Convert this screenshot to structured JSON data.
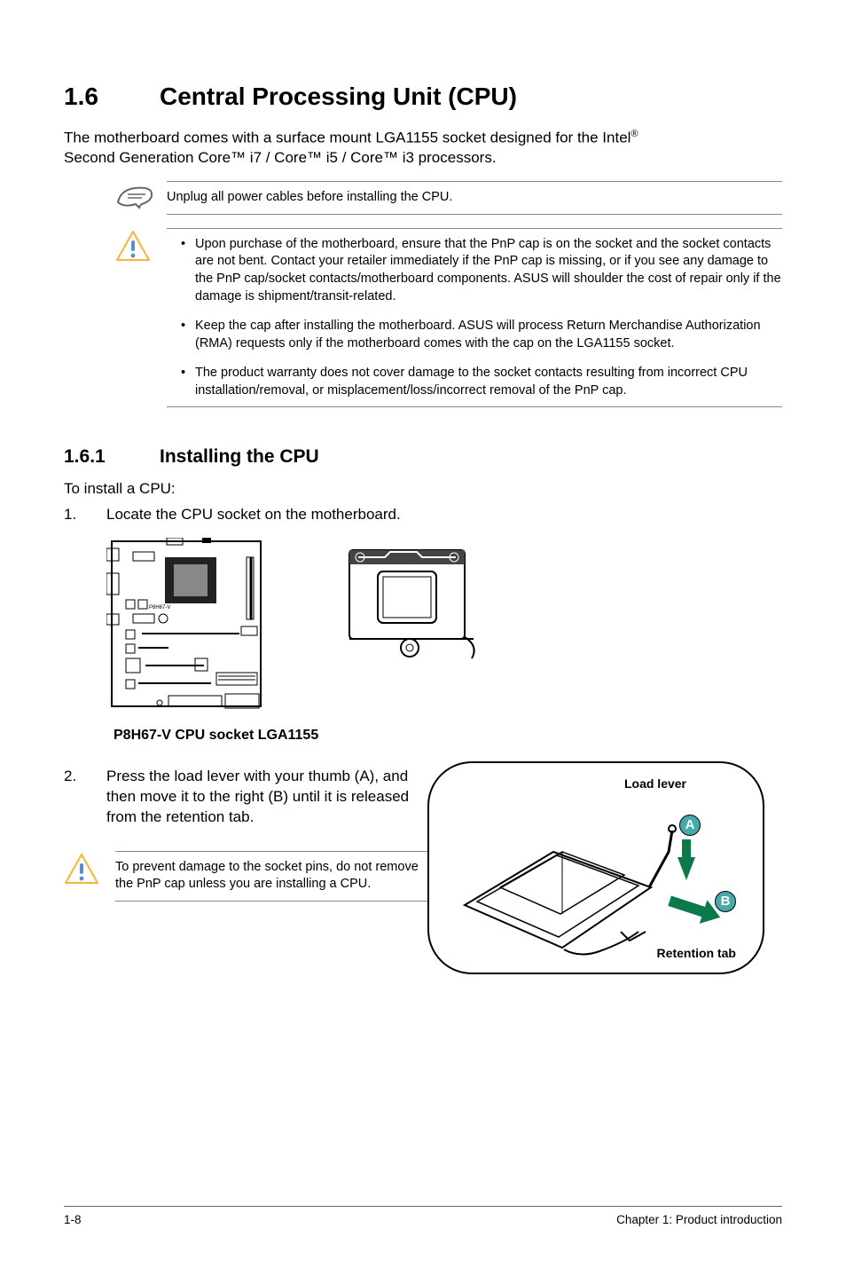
{
  "section": {
    "number": "1.6",
    "title": "Central Processing Unit (CPU)",
    "intro_a": "The motherboard comes with a surface mount LGA1155 socket designed for the Intel",
    "intro_sup": "®",
    "intro_b": "Second Generation Core™ i7 / Core™ i5 / Core™ i3 processors."
  },
  "note_unplug": "Unplug all power cables before installing the CPU.",
  "warnings": [
    "Upon purchase of the motherboard, ensure that the PnP cap is on the socket and the socket contacts are not bent. Contact your retailer immediately if the PnP cap is missing, or if you see any damage to the PnP cap/socket contacts/motherboard components. ASUS will shoulder the cost of repair only if the damage is shipment/transit-related.",
    "Keep the cap after installing the motherboard. ASUS will process Return Merchandise Authorization (RMA) requests only if the motherboard comes with the cap on the LGA1155 socket.",
    "The product warranty does not cover damage to the socket contacts resulting from incorrect CPU installation/removal, or misplacement/loss/incorrect removal of the PnP cap."
  ],
  "subsection": {
    "number": "1.6.1",
    "title": "Installing the CPU",
    "lead": "To install a CPU:"
  },
  "steps": {
    "s1_num": "1.",
    "s1_text": "Locate the CPU socket on the motherboard.",
    "s2_num": "2.",
    "s2_text": "Press the load lever with your thumb (A), and then move it to the right (B) until it is released from the retention tab."
  },
  "diagram_caption": "P8H67-V CPU socket LGA1155",
  "mini_warning": "To prevent damage to the socket pins, do not remove the PnP cap unless you are installing a CPU.",
  "lever_fig": {
    "load_lever": "Load lever",
    "letter_a": "A",
    "letter_b": "B",
    "retention_tab": "Retention tab"
  },
  "footer": {
    "left": "1-8",
    "right": "Chapter 1: Product introduction"
  }
}
